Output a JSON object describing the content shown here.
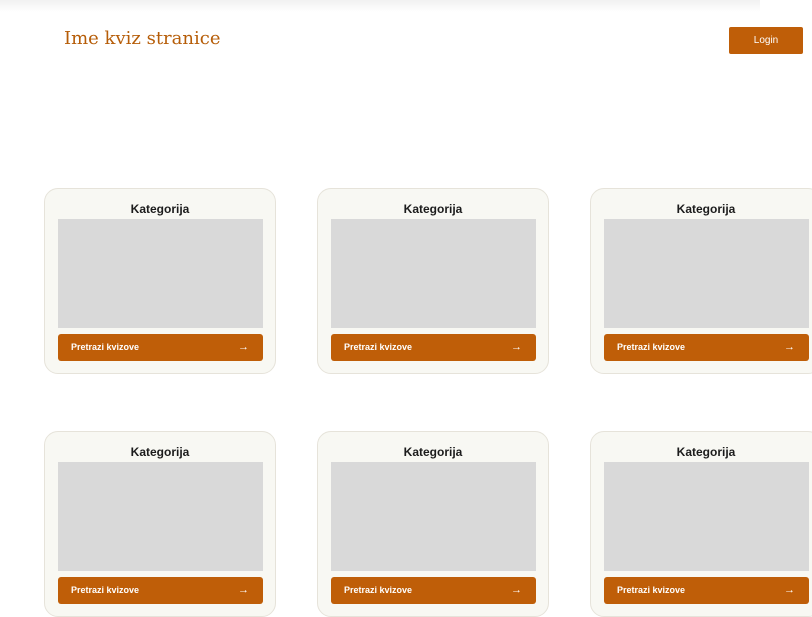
{
  "header": {
    "site_title": "Ime kviz stranice",
    "login_label": "Login"
  },
  "colors": {
    "accent": "#bf5e08",
    "card_background": "#f8f8f3",
    "image_placeholder": "#d9d9d9"
  },
  "cards": [
    {
      "title": "Kategorija",
      "button_label": "Pretrazi kvizove",
      "button_icon": "→"
    },
    {
      "title": "Kategorija",
      "button_label": "Pretrazi kvizove",
      "button_icon": "→"
    },
    {
      "title": "Kategorija",
      "button_label": "Pretrazi kvizove",
      "button_icon": "→"
    },
    {
      "title": "Kategorija",
      "button_label": "Pretrazi kvizove",
      "button_icon": "→"
    },
    {
      "title": "Kategorija",
      "button_label": "Pretrazi kvizove",
      "button_icon": "→"
    },
    {
      "title": "Kategorija",
      "button_label": "Pretrazi kvizove",
      "button_icon": "→"
    }
  ]
}
